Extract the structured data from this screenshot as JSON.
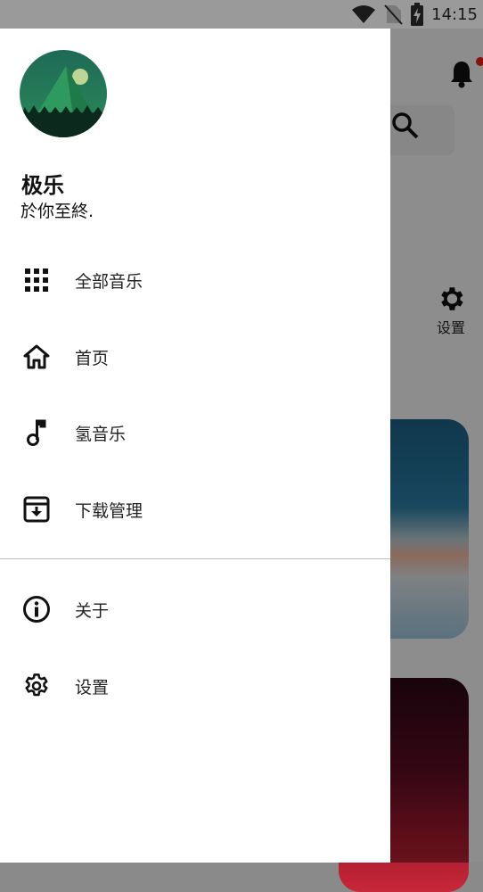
{
  "status_bar": {
    "time": "14:15",
    "icons": [
      "wifi-icon",
      "no-sim-icon",
      "battery-charging-icon"
    ]
  },
  "background_app": {
    "settings_label": "设置",
    "notification_badge_color": "#e52222"
  },
  "drawer": {
    "user": {
      "name": "极乐",
      "tagline": "於你至終."
    },
    "primary_items": [
      {
        "label": "全部音乐",
        "icon": "grid-icon"
      },
      {
        "label": "首页",
        "icon": "home-icon"
      },
      {
        "label": "氢音乐",
        "icon": "music-note-icon"
      },
      {
        "label": "下载管理",
        "icon": "download-archive-icon"
      }
    ],
    "secondary_items": [
      {
        "label": "关于",
        "icon": "info-icon"
      },
      {
        "label": "设置",
        "icon": "gear-icon"
      }
    ]
  },
  "colors": {
    "drawer_bg": "#ffffff",
    "text_primary": "#222222",
    "divider": "#bcbcbc",
    "scrim": "rgba(0,0,0,0.42)"
  }
}
